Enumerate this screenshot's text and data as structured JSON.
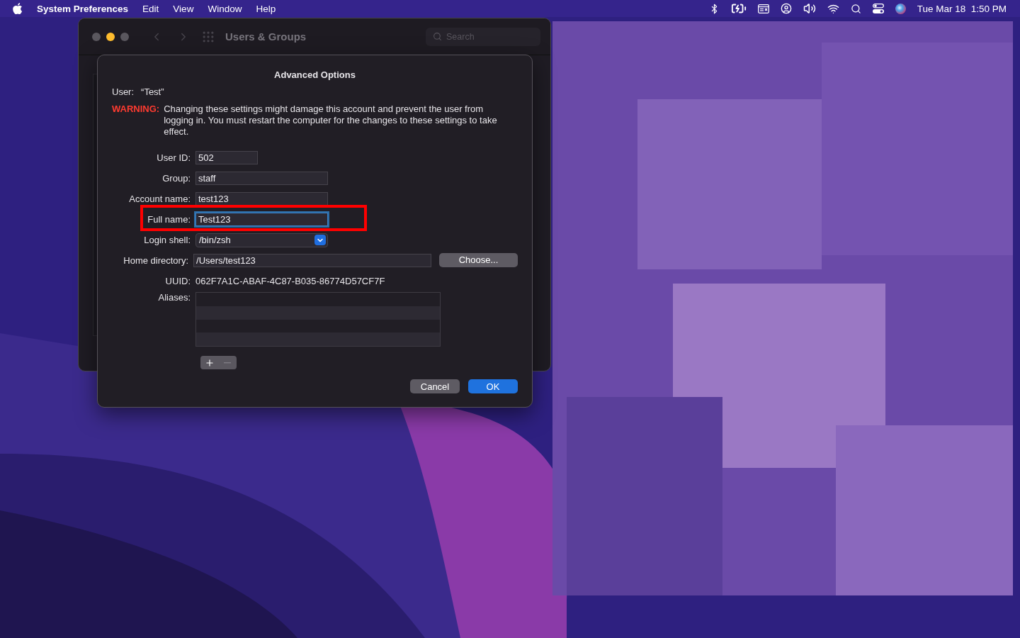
{
  "menu_bar": {
    "app_name": "System Preferences",
    "menus": [
      "Edit",
      "View",
      "Window",
      "Help"
    ],
    "clock": "Tue Mar 18  1:50 PM"
  },
  "window": {
    "title": "Users & Groups",
    "search": {
      "placeholder": "Search"
    }
  },
  "sheet": {
    "title": "Advanced Options",
    "user_label": "User:",
    "user_value": "“Test”",
    "warning_label": "WARNING:",
    "warning_text": "Changing these settings might damage this account and prevent the user from logging in. You must restart the computer for the changes to these settings to take effect.",
    "fields": [
      {
        "label": "User ID:",
        "value": "502",
        "kind": "text",
        "focused": false,
        "highlighted": false
      },
      {
        "label": "Group:",
        "value": "staff",
        "kind": "text",
        "focused": false,
        "highlighted": false
      },
      {
        "label": "Account name:",
        "value": "test123",
        "kind": "text",
        "focused": false,
        "highlighted": false
      },
      {
        "label": "Full name:",
        "value": "Test123",
        "kind": "text",
        "focused": true,
        "highlighted": true
      },
      {
        "label": "Login shell:",
        "value": "/bin/zsh",
        "kind": "popup",
        "focused": false,
        "highlighted": false
      },
      {
        "label": "Home directory:",
        "value": "/Users/test123",
        "kind": "path",
        "button": "Choose...",
        "focused": false,
        "highlighted": false
      }
    ],
    "uuid": {
      "label": "UUID:",
      "value": "062F7A1C-ABAF-4C87-B035-86774D57CF7F"
    },
    "aliases": {
      "label": "Aliases:",
      "remove_disabled": true
    },
    "buttons": [
      {
        "label": "Cancel",
        "default": false
      },
      {
        "label": "OK",
        "default": true
      }
    ]
  }
}
